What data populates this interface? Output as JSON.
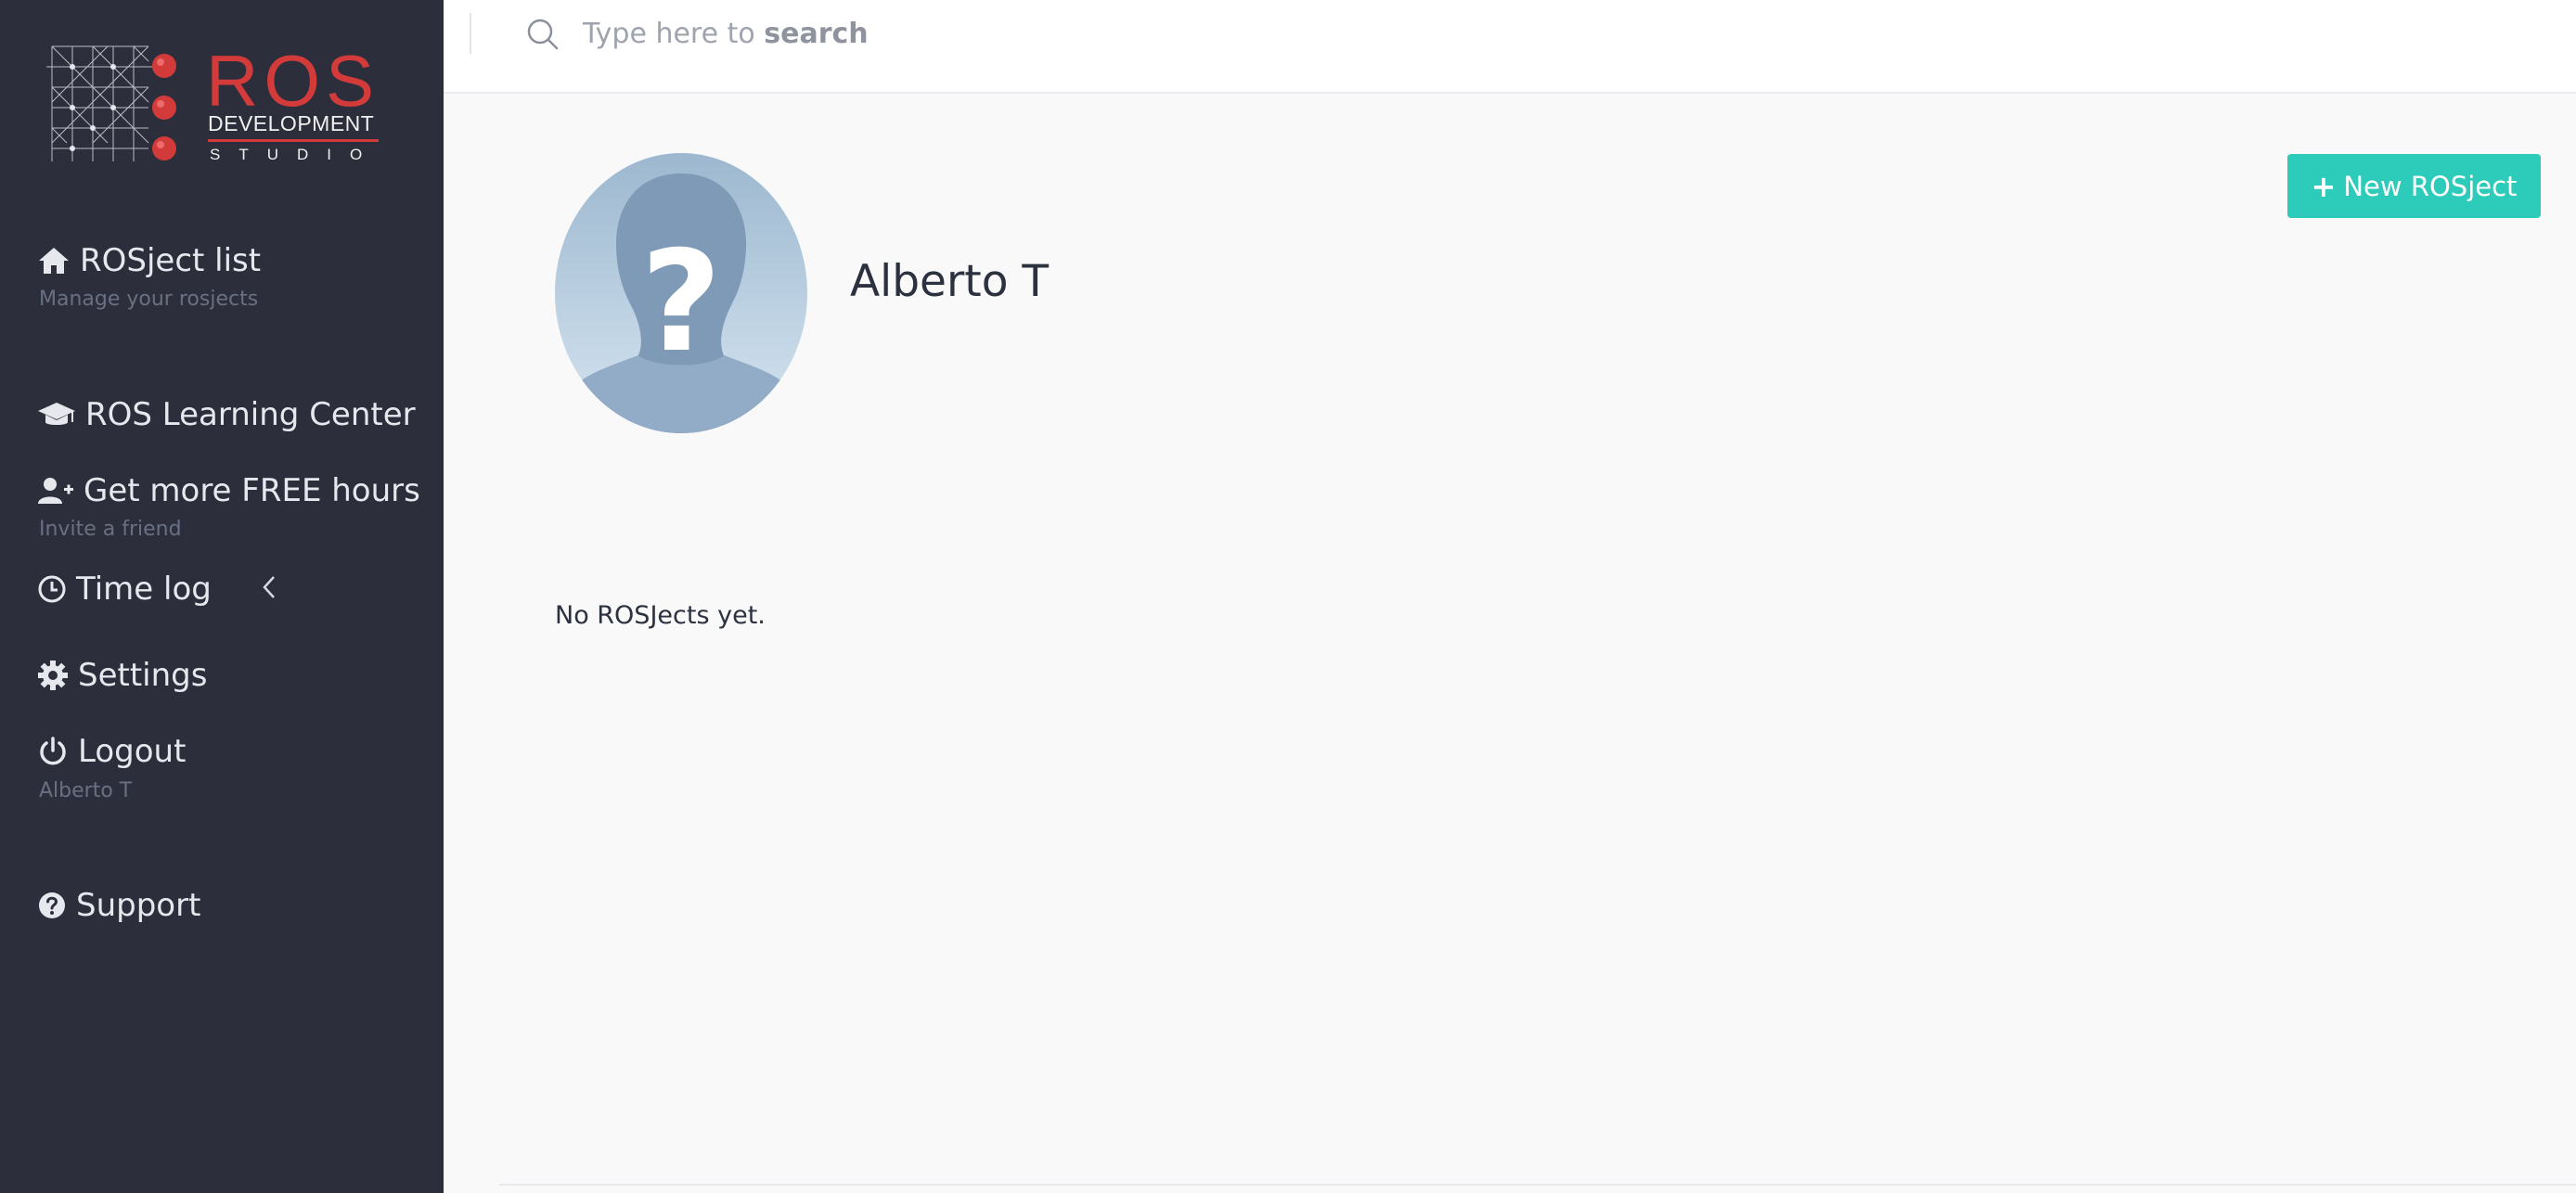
{
  "brand": {
    "logo_ros": "ROS",
    "logo_development": "DEVELOPMENT",
    "logo_studio": "STUDIO",
    "accent_red": "#d33a3a"
  },
  "sidebar": {
    "background": "#2c2f3b",
    "items": [
      {
        "label": "ROSject list",
        "subtitle": "Manage your rosjects",
        "icon": "home-icon"
      },
      {
        "label": "ROS Learning Center",
        "subtitle": "",
        "icon": "graduation-cap-icon"
      },
      {
        "label": "Get more FREE hours",
        "subtitle": "Invite a friend",
        "icon": "user-plus-icon"
      },
      {
        "label": "Time log",
        "subtitle": "",
        "icon": "clock-icon"
      },
      {
        "label": "Settings",
        "subtitle": "",
        "icon": "gear-icon"
      },
      {
        "label": "Logout",
        "subtitle": "Alberto T",
        "icon": "power-icon"
      },
      {
        "label": "Support",
        "subtitle": "",
        "icon": "question-circle-icon"
      }
    ]
  },
  "search": {
    "placeholder_prefix": "Type here to",
    "placeholder_bold": "search",
    "placeholder": "Type here to search"
  },
  "profile": {
    "name": "Alberto T",
    "avatar_icon": "unknown-user-avatar"
  },
  "actions": {
    "new_rosject_label": "New ROSject",
    "accent_teal": "#2dcbba"
  },
  "content": {
    "empty_message": "No ROSJects yet."
  }
}
